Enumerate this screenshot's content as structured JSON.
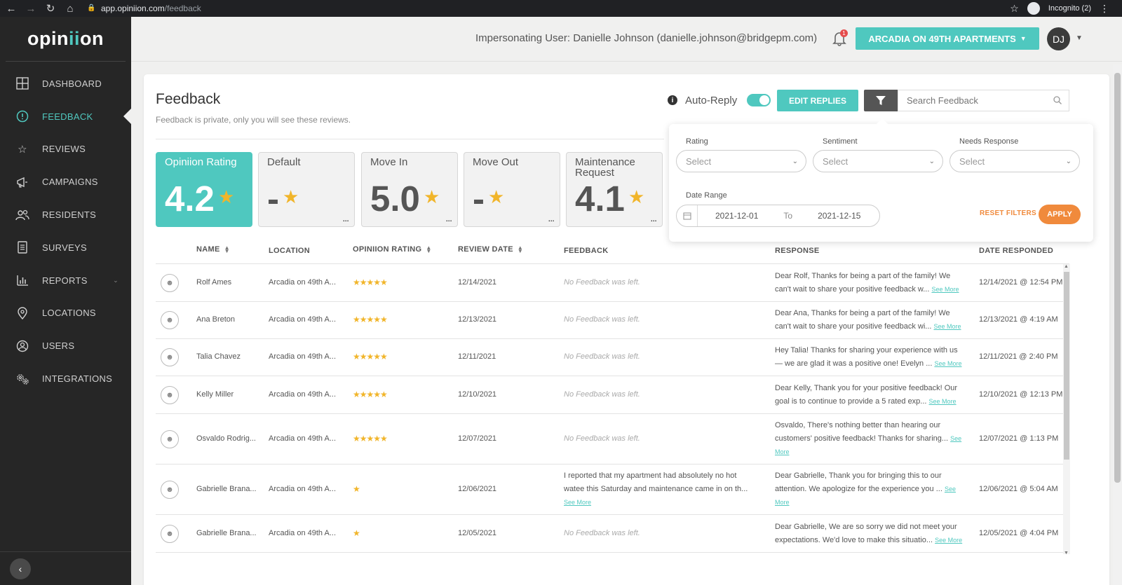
{
  "browser": {
    "url_host": "app.opiniion.com",
    "url_path": "/feedback",
    "incognito_label": "Incognito (2)"
  },
  "sidebar": {
    "logo_pre": "opin",
    "logo_accent": "ii",
    "logo_post": "on",
    "items": [
      {
        "label": "DASHBOARD",
        "icon": "grid-icon"
      },
      {
        "label": "FEEDBACK",
        "icon": "feedback-icon"
      },
      {
        "label": "REVIEWS",
        "icon": "star-icon"
      },
      {
        "label": "CAMPAIGNS",
        "icon": "megaphone-icon"
      },
      {
        "label": "RESIDENTS",
        "icon": "people-icon"
      },
      {
        "label": "SURVEYS",
        "icon": "document-icon"
      },
      {
        "label": "REPORTS",
        "icon": "bar-chart-icon"
      },
      {
        "label": "LOCATIONS",
        "icon": "map-pin-icon"
      },
      {
        "label": "USERS",
        "icon": "user-circle-icon"
      },
      {
        "label": "INTEGRATIONS",
        "icon": "gears-icon"
      }
    ],
    "active": "FEEDBACK"
  },
  "topbar": {
    "impersonating": "Impersonating User: Danielle Johnson (danielle.johnson@bridgepm.com)",
    "notification_count": "1",
    "property": "ARCADIA ON 49TH APARTMENTS",
    "avatar_initials": "DJ"
  },
  "page": {
    "title": "Feedback",
    "subtitle": "Feedback is private, only you will see these reviews.",
    "auto_reply_label": "Auto-Reply",
    "auto_reply_on": true,
    "edit_replies_label": "EDIT REPLIES",
    "search_placeholder": "Search Feedback"
  },
  "tiles": [
    {
      "label": "Opiniion Rating",
      "value": "4.2"
    },
    {
      "label": "Default",
      "value": "-"
    },
    {
      "label": "Move In",
      "value": "5.0"
    },
    {
      "label": "Move Out",
      "value": "-"
    },
    {
      "label": "Maintenance Request",
      "value": "4.1"
    }
  ],
  "table": {
    "headers": {
      "name": "NAME",
      "location": "LOCATION",
      "rating": "OPINIION RATING",
      "review_date": "REVIEW DATE",
      "feedback": "FEEDBACK",
      "response": "RESPONSE",
      "date_responded": "DATE RESPONDED"
    },
    "see_more": "See More",
    "rows": [
      {
        "name": "Rolf Ames",
        "location": "Arcadia on 49th A...",
        "rating": 5,
        "date": "12/14/2021",
        "feedback": "No Feedback was left.",
        "response": "Dear Rolf, Thanks for being a part of the family! We can't wait to share your positive feedback w...",
        "responded": "12/14/2021 @ 12:54 PM"
      },
      {
        "name": "Ana Breton",
        "location": "Arcadia on 49th A...",
        "rating": 5,
        "date": "12/13/2021",
        "feedback": "No Feedback was left.",
        "response": "Dear Ana, Thanks for being a part of the family! We can't wait to share your positive feedback wi...",
        "responded": "12/13/2021 @ 4:19 AM"
      },
      {
        "name": "Talia Chavez",
        "location": "Arcadia on 49th A...",
        "rating": 5,
        "date": "12/11/2021",
        "feedback": "No Feedback was left.",
        "response": "Hey Talia! Thanks for sharing your experience with us — we are glad it was a positive one! Evelyn ...",
        "responded": "12/11/2021 @ 2:40 PM"
      },
      {
        "name": "Kelly Miller",
        "location": "Arcadia on 49th A...",
        "rating": 5,
        "date": "12/10/2021",
        "feedback": "No Feedback was left.",
        "response": "Dear Kelly, Thank you for your positive feedback! Our goal is to continue to provide a 5 rated exp...",
        "responded": "12/10/2021 @ 12:13 PM"
      },
      {
        "name": "Osvaldo Rodrig...",
        "location": "Arcadia on 49th A...",
        "rating": 5,
        "date": "12/07/2021",
        "feedback": "No Feedback was left.",
        "response": "Osvaldo, There's nothing better than hearing our customers' positive feedback! Thanks for sharing...",
        "responded": "12/07/2021 @ 1:13 PM"
      },
      {
        "name": "Gabrielle Brana...",
        "location": "Arcadia on 49th A...",
        "rating": 1,
        "date": "12/06/2021",
        "feedback": "I reported that my apartment had absolutely no hot watee this Saturday and maintenance came in on th...",
        "response": "Dear Gabrielle, Thank you for bringing this to our attention. We apologize for the experience you ...",
        "responded": "12/06/2021 @ 5:04 AM"
      },
      {
        "name": "Gabrielle Brana...",
        "location": "Arcadia on 49th A...",
        "rating": 1,
        "date": "12/05/2021",
        "feedback": "No Feedback was left.",
        "response": "Dear Gabrielle, We are so sorry we did not meet your expectations. We'd love to make this situatio...",
        "responded": "12/05/2021 @ 4:04 PM"
      }
    ]
  },
  "filters": {
    "rating_label": "Rating",
    "sentiment_label": "Sentiment",
    "needs_response_label": "Needs Response",
    "select_placeholder": "Select",
    "date_range_label": "Date Range",
    "date_from": "2021-12-01",
    "date_to_label": "To",
    "date_to": "2021-12-15",
    "reset_label": "RESET FILTERS",
    "apply_label": "APPLY"
  },
  "colors": {
    "accent": "#4fc8bf",
    "sidebar": "#262626",
    "star": "#f1b52a",
    "orange": "#f08a3c"
  }
}
